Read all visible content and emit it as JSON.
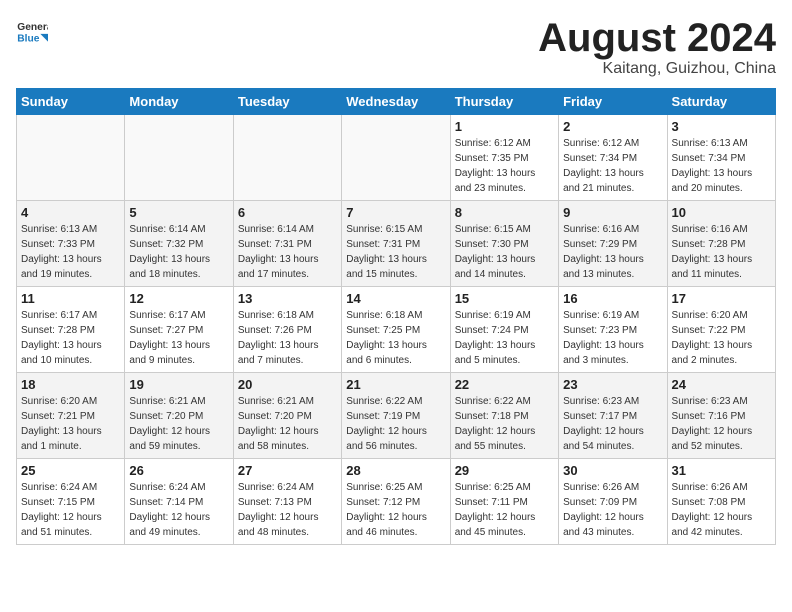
{
  "header": {
    "logo_general": "General",
    "logo_blue": "Blue",
    "month": "August 2024",
    "location": "Kaitang, Guizhou, China"
  },
  "weekdays": [
    "Sunday",
    "Monday",
    "Tuesday",
    "Wednesday",
    "Thursday",
    "Friday",
    "Saturday"
  ],
  "weeks": [
    [
      {
        "day": "",
        "info": ""
      },
      {
        "day": "",
        "info": ""
      },
      {
        "day": "",
        "info": ""
      },
      {
        "day": "",
        "info": ""
      },
      {
        "day": "1",
        "info": "Sunrise: 6:12 AM\nSunset: 7:35 PM\nDaylight: 13 hours\nand 23 minutes."
      },
      {
        "day": "2",
        "info": "Sunrise: 6:12 AM\nSunset: 7:34 PM\nDaylight: 13 hours\nand 21 minutes."
      },
      {
        "day": "3",
        "info": "Sunrise: 6:13 AM\nSunset: 7:34 PM\nDaylight: 13 hours\nand 20 minutes."
      }
    ],
    [
      {
        "day": "4",
        "info": "Sunrise: 6:13 AM\nSunset: 7:33 PM\nDaylight: 13 hours\nand 19 minutes."
      },
      {
        "day": "5",
        "info": "Sunrise: 6:14 AM\nSunset: 7:32 PM\nDaylight: 13 hours\nand 18 minutes."
      },
      {
        "day": "6",
        "info": "Sunrise: 6:14 AM\nSunset: 7:31 PM\nDaylight: 13 hours\nand 17 minutes."
      },
      {
        "day": "7",
        "info": "Sunrise: 6:15 AM\nSunset: 7:31 PM\nDaylight: 13 hours\nand 15 minutes."
      },
      {
        "day": "8",
        "info": "Sunrise: 6:15 AM\nSunset: 7:30 PM\nDaylight: 13 hours\nand 14 minutes."
      },
      {
        "day": "9",
        "info": "Sunrise: 6:16 AM\nSunset: 7:29 PM\nDaylight: 13 hours\nand 13 minutes."
      },
      {
        "day": "10",
        "info": "Sunrise: 6:16 AM\nSunset: 7:28 PM\nDaylight: 13 hours\nand 11 minutes."
      }
    ],
    [
      {
        "day": "11",
        "info": "Sunrise: 6:17 AM\nSunset: 7:28 PM\nDaylight: 13 hours\nand 10 minutes."
      },
      {
        "day": "12",
        "info": "Sunrise: 6:17 AM\nSunset: 7:27 PM\nDaylight: 13 hours\nand 9 minutes."
      },
      {
        "day": "13",
        "info": "Sunrise: 6:18 AM\nSunset: 7:26 PM\nDaylight: 13 hours\nand 7 minutes."
      },
      {
        "day": "14",
        "info": "Sunrise: 6:18 AM\nSunset: 7:25 PM\nDaylight: 13 hours\nand 6 minutes."
      },
      {
        "day": "15",
        "info": "Sunrise: 6:19 AM\nSunset: 7:24 PM\nDaylight: 13 hours\nand 5 minutes."
      },
      {
        "day": "16",
        "info": "Sunrise: 6:19 AM\nSunset: 7:23 PM\nDaylight: 13 hours\nand 3 minutes."
      },
      {
        "day": "17",
        "info": "Sunrise: 6:20 AM\nSunset: 7:22 PM\nDaylight: 13 hours\nand 2 minutes."
      }
    ],
    [
      {
        "day": "18",
        "info": "Sunrise: 6:20 AM\nSunset: 7:21 PM\nDaylight: 13 hours\nand 1 minute."
      },
      {
        "day": "19",
        "info": "Sunrise: 6:21 AM\nSunset: 7:20 PM\nDaylight: 12 hours\nand 59 minutes."
      },
      {
        "day": "20",
        "info": "Sunrise: 6:21 AM\nSunset: 7:20 PM\nDaylight: 12 hours\nand 58 minutes."
      },
      {
        "day": "21",
        "info": "Sunrise: 6:22 AM\nSunset: 7:19 PM\nDaylight: 12 hours\nand 56 minutes."
      },
      {
        "day": "22",
        "info": "Sunrise: 6:22 AM\nSunset: 7:18 PM\nDaylight: 12 hours\nand 55 minutes."
      },
      {
        "day": "23",
        "info": "Sunrise: 6:23 AM\nSunset: 7:17 PM\nDaylight: 12 hours\nand 54 minutes."
      },
      {
        "day": "24",
        "info": "Sunrise: 6:23 AM\nSunset: 7:16 PM\nDaylight: 12 hours\nand 52 minutes."
      }
    ],
    [
      {
        "day": "25",
        "info": "Sunrise: 6:24 AM\nSunset: 7:15 PM\nDaylight: 12 hours\nand 51 minutes."
      },
      {
        "day": "26",
        "info": "Sunrise: 6:24 AM\nSunset: 7:14 PM\nDaylight: 12 hours\nand 49 minutes."
      },
      {
        "day": "27",
        "info": "Sunrise: 6:24 AM\nSunset: 7:13 PM\nDaylight: 12 hours\nand 48 minutes."
      },
      {
        "day": "28",
        "info": "Sunrise: 6:25 AM\nSunset: 7:12 PM\nDaylight: 12 hours\nand 46 minutes."
      },
      {
        "day": "29",
        "info": "Sunrise: 6:25 AM\nSunset: 7:11 PM\nDaylight: 12 hours\nand 45 minutes."
      },
      {
        "day": "30",
        "info": "Sunrise: 6:26 AM\nSunset: 7:09 PM\nDaylight: 12 hours\nand 43 minutes."
      },
      {
        "day": "31",
        "info": "Sunrise: 6:26 AM\nSunset: 7:08 PM\nDaylight: 12 hours\nand 42 minutes."
      }
    ]
  ]
}
